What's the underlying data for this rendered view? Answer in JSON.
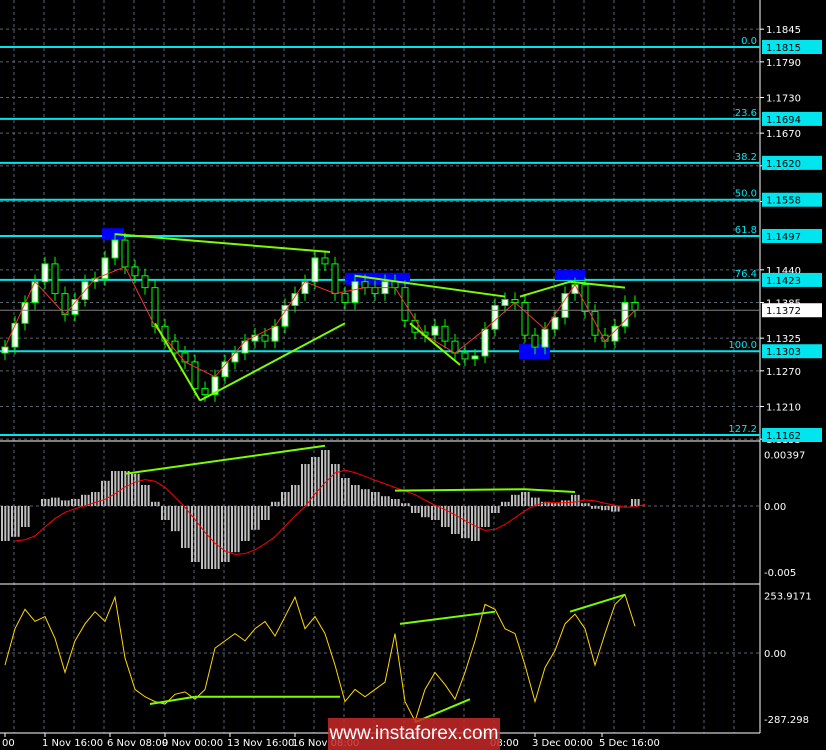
{
  "chart_data": {
    "type": "candlestick",
    "symbol_hint": "",
    "price_panel": {
      "y_ticks": [
        "1.1845",
        "1.1790",
        "1.1730",
        "1.1670",
        "1.1615",
        "1.1555",
        "1.1440",
        "1.1385",
        "1.1325",
        "1.1270",
        "1.1210",
        "1.1155"
      ],
      "current_price": "1.1372",
      "closes": [
        1.131,
        1.135,
        1.1385,
        1.142,
        1.145,
        1.14,
        1.1365,
        1.139,
        1.142,
        1.1425,
        1.146,
        1.149,
        1.1445,
        1.143,
        1.141,
        1.1345,
        1.132,
        1.13,
        1.1285,
        1.124,
        1.123,
        1.126,
        1.1285,
        1.13,
        1.132,
        1.133,
        1.132,
        1.1345,
        1.138,
        1.14,
        1.142,
        1.146,
        1.145,
        1.14,
        1.1385,
        1.142,
        1.141,
        1.14,
        1.142,
        1.141,
        1.1355,
        1.1335,
        1.133,
        1.1345,
        1.132,
        1.13,
        1.129,
        1.1295,
        1.134,
        1.138,
        1.139,
        1.1385,
        1.133,
        1.131,
        1.134,
        1.136,
        1.14,
        1.1415,
        1.137,
        1.133,
        1.132,
        1.1345,
        1.1385,
        1.1372
      ],
      "fibonacci": [
        {
          "level": "0.0",
          "price": "1.1815"
        },
        {
          "level": "23.6",
          "price": "1.1694"
        },
        {
          "level": "38.2",
          "price": "1.1620"
        },
        {
          "level": "50.0",
          "price": "1.1558"
        },
        {
          "level": "61.8",
          "price": "1.1497"
        },
        {
          "level": "76.4",
          "price": "1.1423"
        },
        {
          "level": "100.0",
          "price": "1.1303"
        },
        {
          "level": "127.2",
          "price": "1.1162"
        }
      ],
      "trendlines": [
        [
          11,
          1.15,
          32.5,
          1.147
        ],
        [
          15,
          1.135,
          19.5,
          1.122
        ],
        [
          19.5,
          1.122,
          34,
          1.135
        ],
        [
          35,
          1.143,
          50,
          1.1395
        ],
        [
          40.5,
          1.135,
          45.5,
          1.128
        ],
        [
          51.5,
          1.1395,
          56.5,
          1.142
        ],
        [
          56.5,
          1.142,
          62,
          1.141
        ]
      ],
      "highlight_boxes": [
        [
          9.7,
          11.9,
          1.149,
          1.151
        ],
        [
          34,
          38,
          1.1415,
          1.1435
        ],
        [
          38,
          40.5,
          1.1415,
          1.1435
        ],
        [
          51.4,
          54.5,
          1.129,
          1.1315
        ],
        [
          55,
          58,
          1.1423,
          1.144
        ]
      ]
    },
    "macd_panel": {
      "y_ticks": [
        "0.00397",
        "0.00",
        "-0.005"
      ],
      "histogram": [
        -2.5,
        -2.2,
        -1.5,
        0,
        0.5,
        0.6,
        0.4,
        0.5,
        0.8,
        1.0,
        1.8,
        2.5,
        2.5,
        2.3,
        1.5,
        0.3,
        -1.0,
        -1.8,
        -3.0,
        -4.0,
        -4.5,
        -4.5,
        -4.0,
        -3.3,
        -2.5,
        -1.7,
        -1.0,
        0.3,
        1.0,
        1.5,
        3.0,
        3.5,
        4.0,
        3.0,
        2.0,
        1.5,
        1.2,
        1.0,
        0.7,
        0.5,
        0.2,
        -0.5,
        -0.8,
        -1.0,
        -1.5,
        -2.0,
        -2.3,
        -2.5,
        -1.5,
        -0.5,
        0.3,
        0.8,
        1.0,
        0.6,
        0.3,
        0.2,
        0.4,
        0.8,
        0.2,
        -0.2,
        -0.3,
        -0.4,
        0.0,
        0.5
      ],
      "trendlines": [
        [
          12,
          2.3,
          32,
          4.3
        ],
        [
          39,
          1.1,
          52,
          1.2
        ],
        [
          52,
          1.2,
          57,
          1.0
        ]
      ]
    },
    "cci_panel": {
      "y_ticks": [
        "253.9171",
        "0.00",
        "-287.298"
      ],
      "values": [
        -50,
        100,
        180,
        130,
        150,
        60,
        -80,
        50,
        120,
        170,
        130,
        230,
        -20,
        -150,
        -180,
        -200,
        -210,
        -170,
        -160,
        -190,
        -150,
        20,
        50,
        80,
        50,
        100,
        130,
        70,
        150,
        230,
        100,
        150,
        80,
        -50,
        -200,
        -150,
        -180,
        -150,
        -120,
        80,
        -200,
        -280,
        -150,
        -80,
        -130,
        -190,
        -80,
        50,
        200,
        180,
        100,
        80,
        -50,
        -200,
        -60,
        10,
        120,
        160,
        100,
        -50,
        80,
        200,
        240,
        110
      ],
      "trendlines": [
        [
          14.5,
          -210,
          19,
          -180
        ],
        [
          19,
          -180,
          33.5,
          -180
        ],
        [
          39.5,
          120,
          49,
          170
        ],
        [
          41,
          -285,
          46.5,
          -190
        ],
        [
          56.5,
          170,
          62,
          240
        ]
      ]
    },
    "x_ticks": [
      {
        "label": "00",
        "index": 0
      },
      {
        "label": "1 Nov 16:00",
        "index": 4
      },
      {
        "label": "6 Nov 08:00",
        "index": 10.5
      },
      {
        "label": "9 Nov 00:00",
        "index": 16
      },
      {
        "label": "13 Nov 16:00",
        "index": 22.5
      },
      {
        "label": "16 Nov 08:00",
        "index": 29
      },
      {
        "label": "08:00",
        "index": 48.8
      },
      {
        "label": "3 Dec 00:00",
        "index": 53
      },
      {
        "label": "5 Dec 16:00",
        "index": 59.7
      }
    ],
    "colors": {
      "background": "#000000",
      "fib": "#00e5ee",
      "trend": "#7cfc00",
      "bull": "#ffffff",
      "bear": "#000000",
      "candle_outline": "#00ff00",
      "macd_hist": "#c0c0c0",
      "macd_signal": "#ff0000",
      "cci": "#ffd700",
      "box": "#0000ff",
      "grid": "#5a6470"
    }
  },
  "watermark": "www.instaforex.com"
}
